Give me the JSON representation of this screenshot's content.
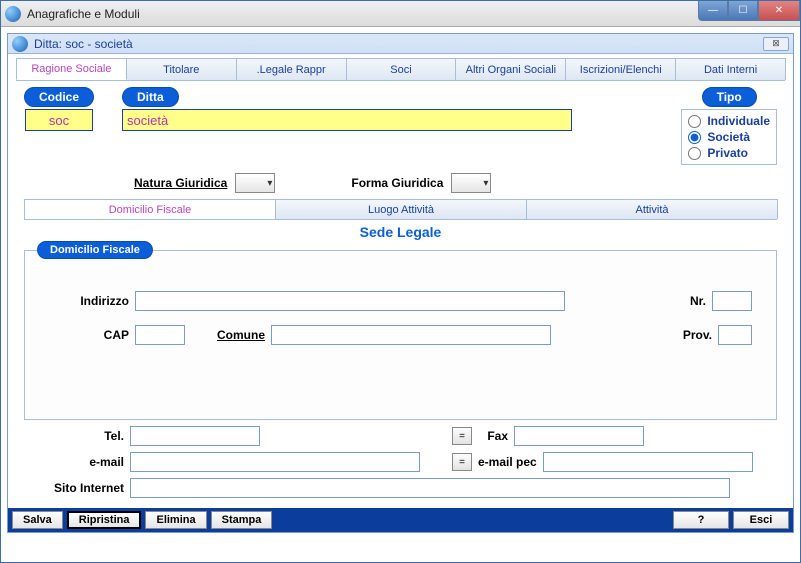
{
  "window": {
    "title": "Anagrafiche e Moduli"
  },
  "inner": {
    "title": "Ditta: soc - società",
    "close": "⊠"
  },
  "tabs": {
    "items": [
      {
        "label": "Ragione Sociale"
      },
      {
        "label": "Titolare"
      },
      {
        "label": ".Legale Rappr"
      },
      {
        "label": "Soci"
      },
      {
        "label": "Altri Organi Sociali"
      },
      {
        "label": "Iscrizioni/Elenchi"
      },
      {
        "label": "Dati Interni"
      }
    ]
  },
  "header": {
    "codice_label": "Codice",
    "codice_value": "soc",
    "ditta_label": "Ditta",
    "ditta_value": "società",
    "tipo_label": "Tipo",
    "tipo_options": {
      "individuale": "Individuale",
      "societa": "Società",
      "privato": "Privato"
    },
    "tipo_selected": "societa",
    "natura_label": "Natura Giuridica",
    "forma_label": "Forma Giuridica"
  },
  "sub_tabs": {
    "items": [
      {
        "label": "Domicilio Fiscale"
      },
      {
        "label": "Luogo Attività"
      },
      {
        "label": "Attività"
      }
    ]
  },
  "sede": {
    "title": "Sede Legale",
    "group": "Domicilio Fiscale",
    "indirizzo": "Indirizzo",
    "indirizzo_val": "",
    "nr": "Nr.",
    "nr_val": "",
    "cap": "CAP",
    "cap_val": "",
    "comune": "Comune",
    "comune_val": "",
    "prov": "Prov.",
    "prov_val": ""
  },
  "contacts": {
    "tel": "Tel.",
    "tel_val": "",
    "fax": "Fax",
    "fax_val": "",
    "email": "e-mail",
    "email_val": "",
    "email_pec": "e-mail pec",
    "email_pec_val": "",
    "sito": "Sito Internet",
    "sito_val": "",
    "eq": "="
  },
  "buttons": {
    "salva": "Salva",
    "ripristina": "Ripristina",
    "elimina": "Elimina",
    "stampa": "Stampa",
    "help": "?",
    "esci": "Esci"
  },
  "win_controls": {
    "min": "—",
    "max": "☐",
    "close": "✕"
  }
}
